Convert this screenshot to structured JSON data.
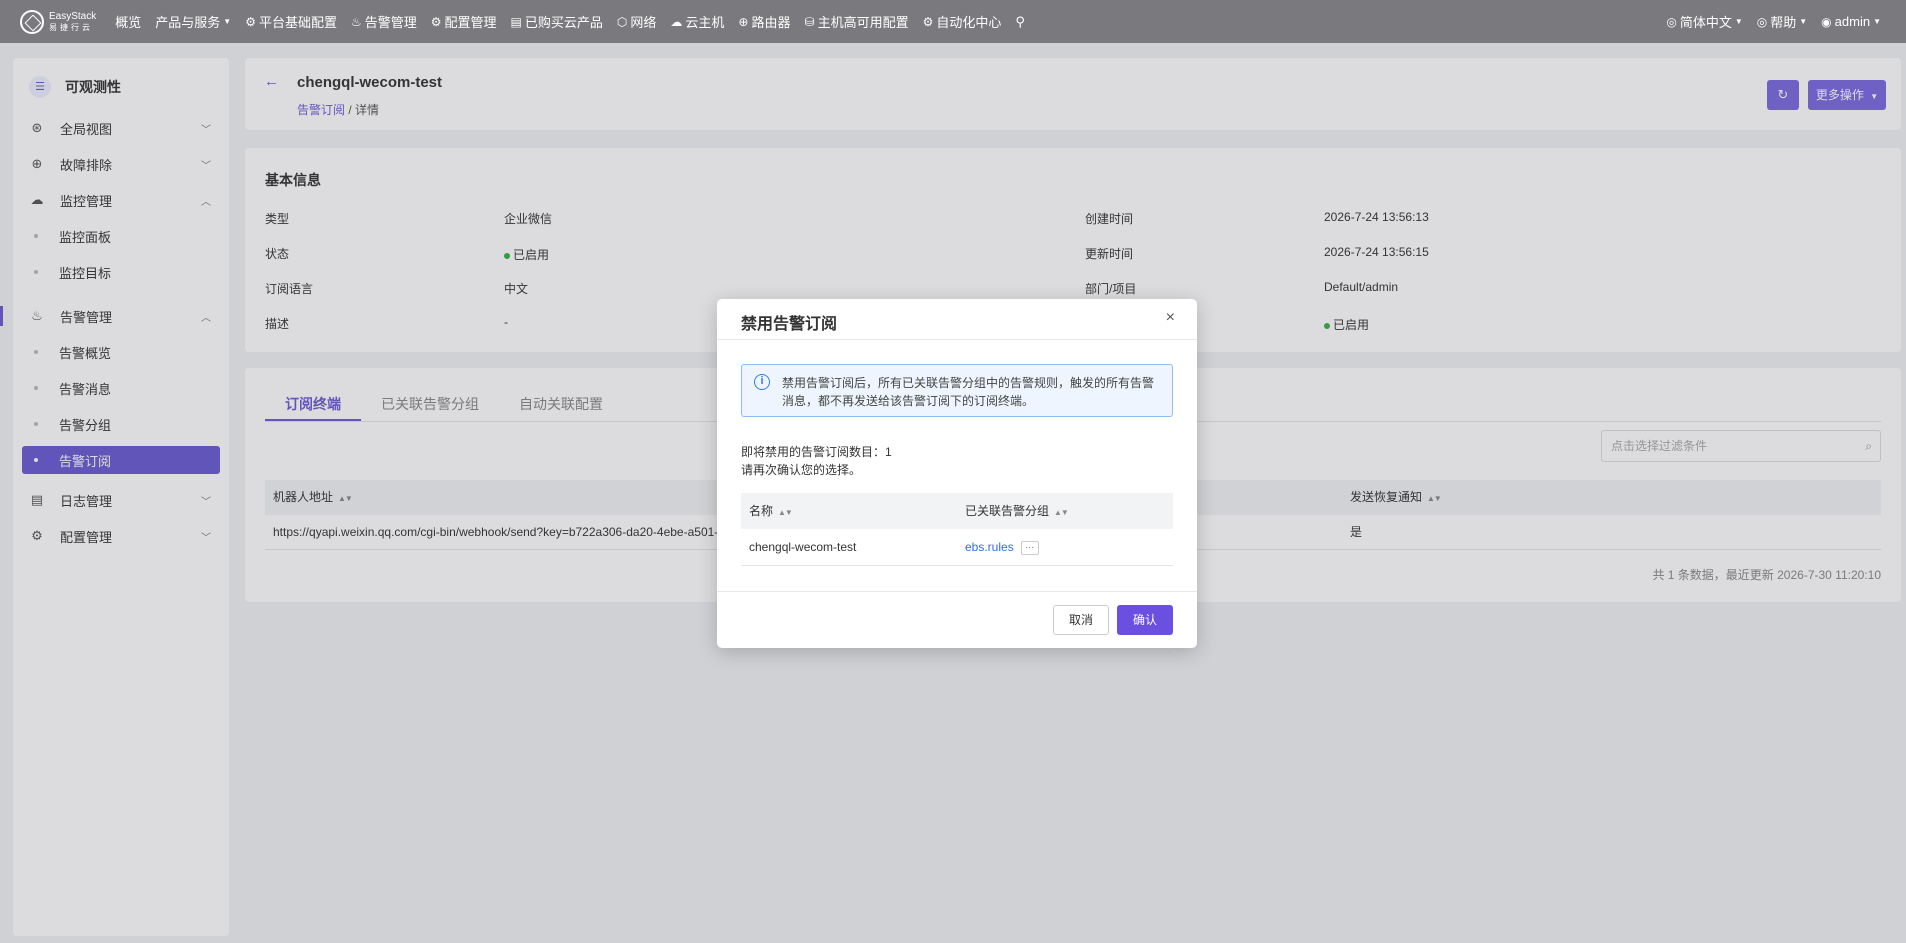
{
  "brand": {
    "name": "EasyStack",
    "sub": "易捷行云"
  },
  "nav": {
    "items": [
      {
        "icon": "",
        "label": "概览",
        "caret": false
      },
      {
        "icon": "",
        "label": "产品与服务",
        "caret": true
      },
      {
        "icon": "⚙",
        "label": "平台基础配置",
        "caret": false
      },
      {
        "icon": "♨",
        "label": "告警管理",
        "caret": false
      },
      {
        "icon": "⚙",
        "label": "配置管理",
        "caret": false
      },
      {
        "icon": "▤",
        "label": "已购买云产品",
        "caret": false
      },
      {
        "icon": "⬡",
        "label": "网络",
        "caret": false
      },
      {
        "icon": "☁",
        "label": "云主机",
        "caret": false
      },
      {
        "icon": "⊕",
        "label": "路由器",
        "caret": false
      },
      {
        "icon": "⛁",
        "label": "主机高可用配置",
        "caret": false
      },
      {
        "icon": "⚙",
        "label": "自动化中心",
        "caret": false
      }
    ],
    "language": "简体中文",
    "help": "帮助",
    "user": "admin"
  },
  "sidebar": {
    "title": "可观测性",
    "items": [
      {
        "label": "全局视图",
        "type": "group",
        "open": false
      },
      {
        "label": "故障排除",
        "type": "group",
        "open": false
      },
      {
        "label": "监控管理",
        "type": "group",
        "open": true
      },
      {
        "label": "监控面板",
        "type": "sub"
      },
      {
        "label": "监控目标",
        "type": "sub"
      },
      {
        "label": "告警管理",
        "type": "group",
        "open": true
      },
      {
        "label": "告警概览",
        "type": "sub"
      },
      {
        "label": "告警消息",
        "type": "sub"
      },
      {
        "label": "告警分组",
        "type": "sub"
      },
      {
        "label": "告警订阅",
        "type": "sub",
        "active": true
      },
      {
        "label": "日志管理",
        "type": "group",
        "open": false
      },
      {
        "label": "配置管理",
        "type": "group",
        "open": false
      }
    ]
  },
  "header": {
    "title": "chengql-wecom-test",
    "crumb_link": "告警订阅",
    "crumb_sep": " / ",
    "crumb_current": "详情",
    "more_label": "更多操作"
  },
  "info": {
    "title": "基本信息",
    "type_label": "类型",
    "type_value": "企业微信",
    "status_label": "状态",
    "status_value": "已启用",
    "lang_label": "订阅语言",
    "lang_value": "中文",
    "desc_label": "描述",
    "desc_value": "-",
    "created_label": "创建时间",
    "created_value": "2026-7-24 13:56:13",
    "updated_label": "更新时间",
    "updated_value": "2026-7-24 13:56:15",
    "dept_label": "部门/项目",
    "dept_value": "Default/admin",
    "status2_value": "已启用"
  },
  "tabs": [
    "订阅终端",
    "已关联告警分组",
    "自动关联配置"
  ],
  "table": {
    "filter_placeholder": "点击选择过滤条件",
    "col_url": "机器人地址",
    "col_recover": "发送恢复通知",
    "row_url": "https://qyapi.weixin.qq.com/cgi-bin/webhook/send?key=b722a306-da20-4ebe-a501-",
    "row_recover": "是",
    "footer": "共 1 条数据，最近更新  2026-7-30 11:20:10"
  },
  "modal": {
    "title": "禁用告警订阅",
    "alert": "禁用告警订阅后，所有已关联告警分组中的告警规则，触发的所有告警消息，都不再发送给该告警订阅下的订阅终端。",
    "count_text": "即将禁用的告警订阅数目：1",
    "confirm_text": "请再次确认您的选择。",
    "col_name": "名称",
    "col_group": "已关联告警分组",
    "row_name": "chengql-wecom-test",
    "row_group": "ebs.rules",
    "cancel": "取消",
    "ok": "确认"
  }
}
